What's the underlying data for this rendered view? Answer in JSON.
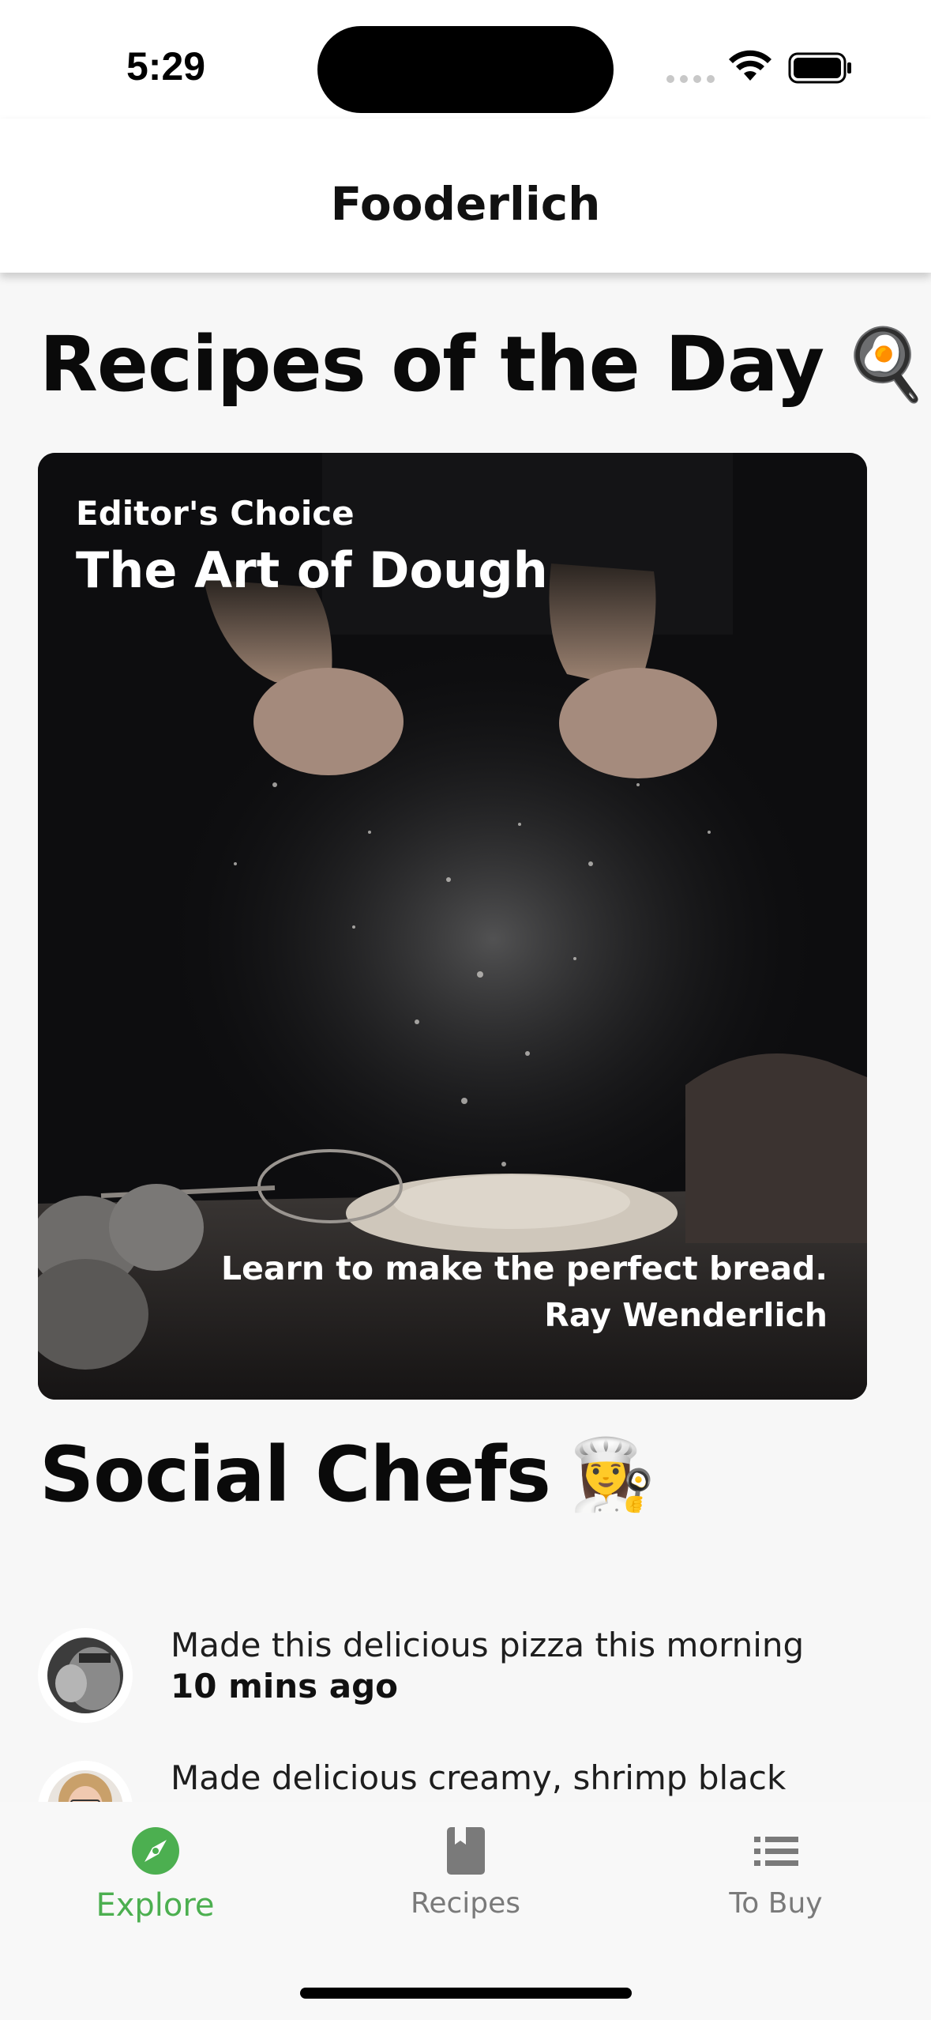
{
  "status": {
    "time": "5:29"
  },
  "appbar": {
    "title": "Fooderlich"
  },
  "recipes_section": {
    "title": "Recipes of the Day",
    "emoji": "🍳"
  },
  "card": {
    "eyebrow": "Editor's Choice",
    "title": "The Art of Dough",
    "description": "Learn to make the perfect bread.",
    "author": "Ray Wenderlich"
  },
  "chefs_section": {
    "title": "Social Chefs",
    "emoji": "👩‍🍳"
  },
  "chefs": [
    {
      "message": "Made this delicious pizza this morning",
      "time": "10 mins ago"
    },
    {
      "message": "Made delicious creamy, shrimp black pepper pasta.",
      "time": ""
    }
  ],
  "nav": {
    "items": [
      {
        "label": "Explore",
        "icon": "compass-icon",
        "active": true
      },
      {
        "label": "Recipes",
        "icon": "book-icon",
        "active": false
      },
      {
        "label": "To Buy",
        "icon": "list-icon",
        "active": false
      }
    ],
    "active_color": "#4caf50",
    "inactive_color": "#7a7a7a"
  }
}
